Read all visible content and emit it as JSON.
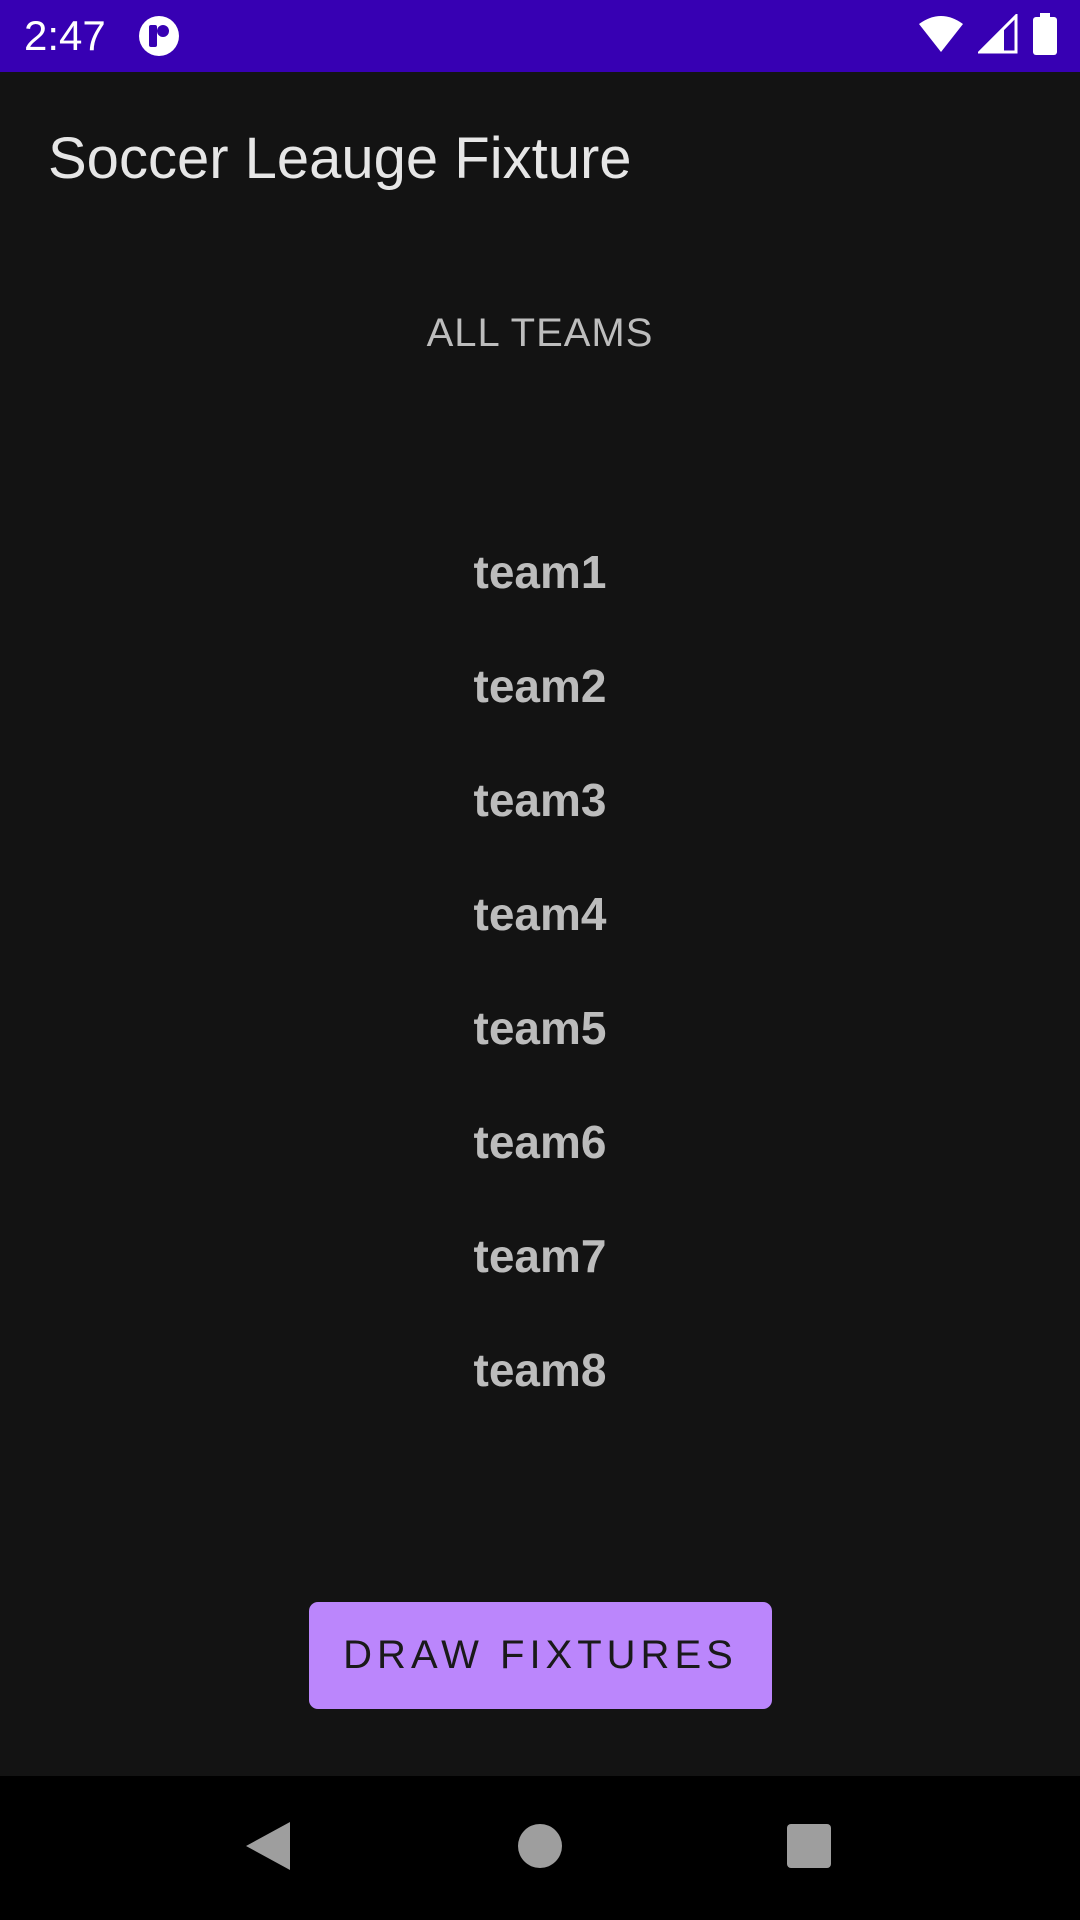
{
  "status_bar": {
    "time": "2:47",
    "background": "#3700b3",
    "icons": [
      "app-notification-icon",
      "wifi-icon",
      "cell-signal-icon",
      "battery-icon"
    ]
  },
  "app_bar": {
    "title": "Soccer Leauge Fixture"
  },
  "main": {
    "section_header": "ALL TEAMS",
    "teams": [
      "team1",
      "team2",
      "team3",
      "team4",
      "team5",
      "team6",
      "team7",
      "team8"
    ],
    "draw_button_label": "DRAW FIXTURES",
    "accent_color": "#bb86fc"
  },
  "nav_bar": {
    "icons": [
      "back-icon",
      "home-icon",
      "recents-icon"
    ]
  }
}
